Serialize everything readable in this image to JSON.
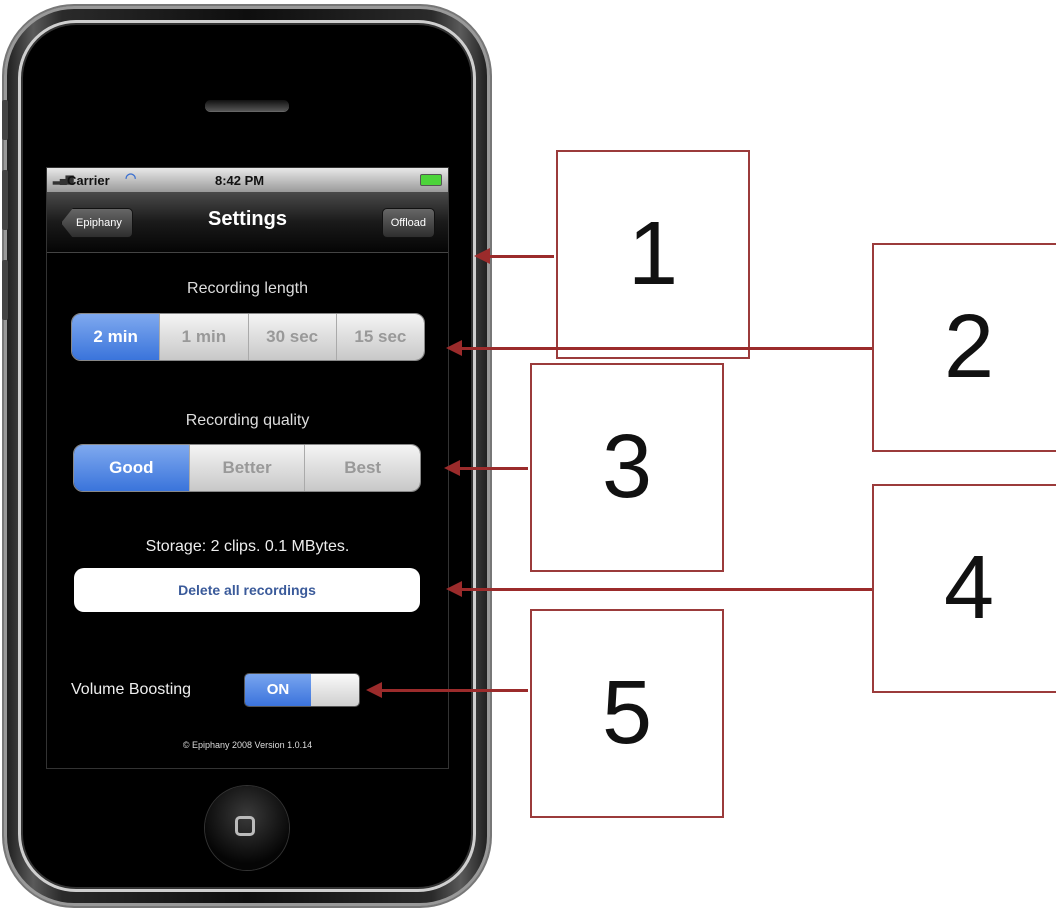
{
  "statusbar": {
    "carrier": "Carrier",
    "time": "8:42 PM",
    "signal_icon": "signal-bars-icon",
    "wifi_icon": "wifi-icon",
    "battery_icon": "battery-icon"
  },
  "navbar": {
    "back_label": "Epiphany",
    "title": "Settings",
    "right_label": "Offload"
  },
  "recording_length": {
    "label": "Recording length",
    "options": [
      "2 min",
      "1 min",
      "30 sec",
      "15 sec"
    ],
    "selected": "2 min"
  },
  "recording_quality": {
    "label": "Recording quality",
    "options": [
      "Good",
      "Better",
      "Best"
    ],
    "selected": "Good"
  },
  "storage": {
    "text": "Storage:  2 clips.  0.1 MBytes."
  },
  "delete_button": {
    "label": "Delete all recordings"
  },
  "volume": {
    "label": "Volume Boosting",
    "toggle_label": "ON",
    "state": "on"
  },
  "footer": {
    "text": "© Epiphany 2008 Version 1.0.14"
  },
  "callouts": [
    "1",
    "2",
    "3",
    "4",
    "5"
  ],
  "colors": {
    "accent_blue": "#3a74db",
    "callout_border": "#9b3b3b",
    "arrow": "#9b2b2b"
  }
}
